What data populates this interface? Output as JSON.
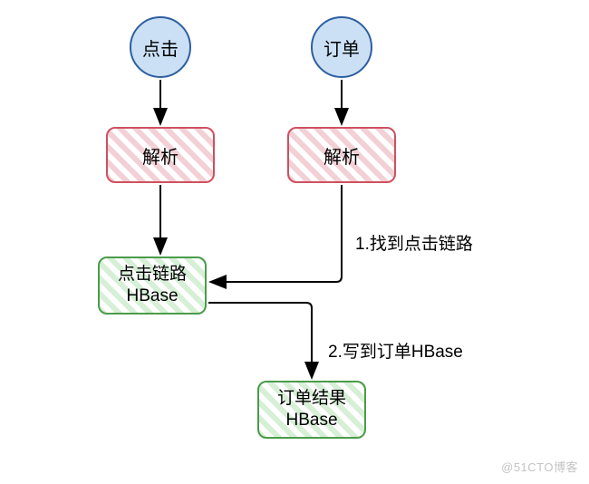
{
  "nodes": {
    "click_start": "点击",
    "order_start": "订单",
    "parse_click": "解析",
    "parse_order": "解析",
    "click_chain_hbase_line1": "点击链路",
    "click_chain_hbase_line2": "HBase",
    "order_result_hbase_line1": "订单结果",
    "order_result_hbase_line2": "HBase"
  },
  "edge_labels": {
    "find_click_chain": "1.找到点击链路",
    "write_order_hbase": "2.写到订单HBase"
  },
  "watermark": "@51CTO博客",
  "chart_data": {
    "type": "diagram",
    "description": "Flowchart showing click and order event processing via parse steps into HBase stores",
    "nodes": [
      {
        "id": "click_start",
        "label": "点击",
        "shape": "circle",
        "fill": "blue"
      },
      {
        "id": "order_start",
        "label": "订单",
        "shape": "circle",
        "fill": "blue"
      },
      {
        "id": "parse_click",
        "label": "解析",
        "shape": "rounded-rect",
        "fill": "red-hatch"
      },
      {
        "id": "parse_order",
        "label": "解析",
        "shape": "rounded-rect",
        "fill": "red-hatch"
      },
      {
        "id": "click_chain_hbase",
        "label": "点击链路\nHBase",
        "shape": "rounded-rect",
        "fill": "green-hatch"
      },
      {
        "id": "order_result_hbase",
        "label": "订单结果\nHBase",
        "shape": "rounded-rect",
        "fill": "green-hatch"
      }
    ],
    "edges": [
      {
        "from": "click_start",
        "to": "parse_click"
      },
      {
        "from": "order_start",
        "to": "parse_order"
      },
      {
        "from": "parse_click",
        "to": "click_chain_hbase"
      },
      {
        "from": "parse_order",
        "to": "click_chain_hbase",
        "label": "1.找到点击链路"
      },
      {
        "from": "parse_order",
        "to": "order_result_hbase",
        "via": "click_chain_hbase",
        "label": "2.写到订单HBase"
      }
    ]
  }
}
